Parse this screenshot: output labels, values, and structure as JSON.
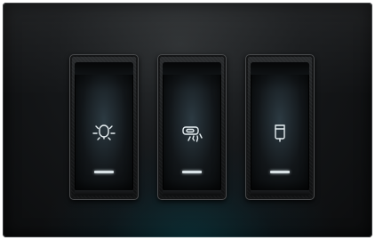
{
  "panel": {
    "background": "#151719",
    "switches": [
      {
        "icon": "light-bulb-icon",
        "indicator_color": "#d9e2e6"
      },
      {
        "icon": "washer-spray-icon",
        "indicator_color": "#d9e2e6"
      },
      {
        "icon": "water-heater-icon",
        "indicator_color": "#d9e2e6"
      }
    ]
  }
}
